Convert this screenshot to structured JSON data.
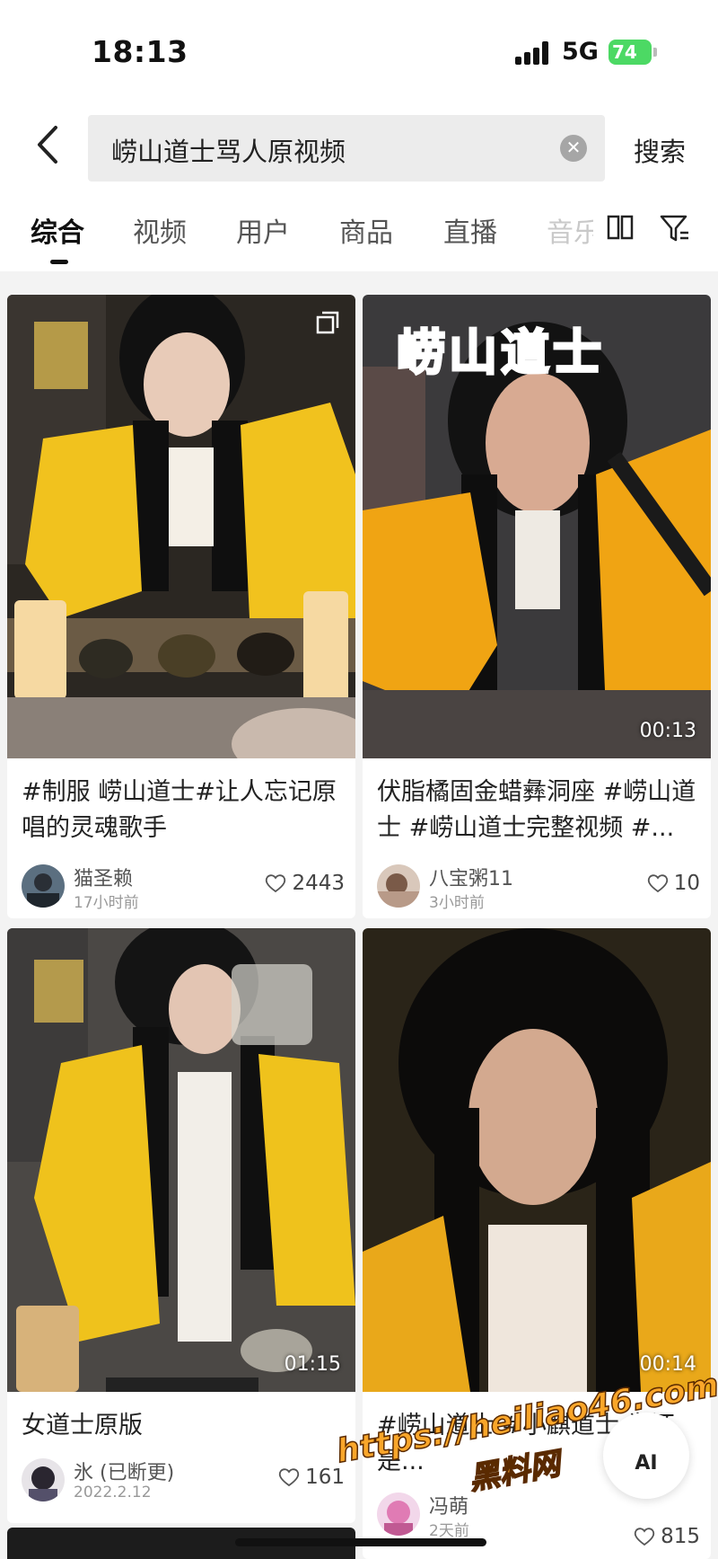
{
  "status_bar": {
    "time": "18:13",
    "network": "5G",
    "battery": "74"
  },
  "search": {
    "query": "崂山道士骂人原视频",
    "submit_label": "搜索"
  },
  "tabs": [
    {
      "label": "综合",
      "active": true
    },
    {
      "label": "视频"
    },
    {
      "label": "用户"
    },
    {
      "label": "商品"
    },
    {
      "label": "直播"
    },
    {
      "label": "音乐"
    }
  ],
  "results": [
    {
      "title": "#制服 崂山道士#让人忘记原唱的灵魂歌手",
      "author": "猫圣赖",
      "time": "17小时前",
      "likes": "2443",
      "duration": ""
    },
    {
      "title": "伏脂橘固金蜡彝洞座 #崂山道士 #崂山道士完整视频 #...",
      "author": "八宝粥11",
      "time": "3小时前",
      "likes": "10",
      "duration": "00:13",
      "overlay_text": "崂山道士"
    },
    {
      "title": "女道士原版",
      "author": "氷 (已断更)",
      "time": "2022.2.12",
      "likes": "161",
      "duration": "01:15"
    },
    {
      "title": "#崂山道士 #小麒道士 为还是...",
      "author": "冯萌",
      "time": "2天前",
      "likes": "815",
      "duration": "00:14"
    }
  ],
  "ai_button": "AI",
  "watermark": {
    "url": "https://heiliao46.com",
    "name": "黑料网"
  },
  "colors": {
    "accent_green": "#4cd964",
    "overlay_red": "#ff3a4f",
    "watermark_orange": "#f9a62a"
  }
}
